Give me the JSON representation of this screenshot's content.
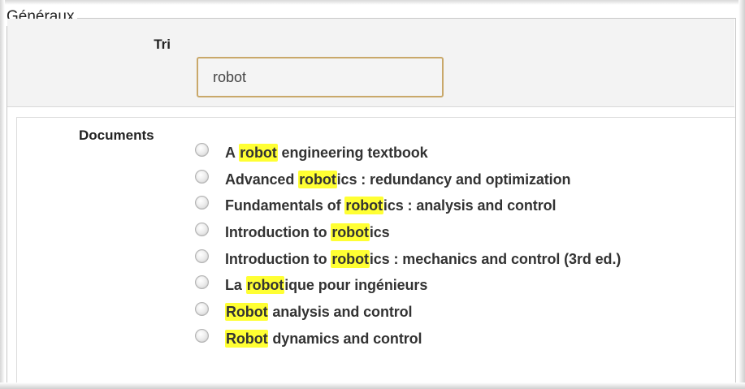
{
  "fieldset": {
    "legend": "Généraux"
  },
  "tri": {
    "label": "Tri",
    "value": "robot"
  },
  "documents": {
    "label": "Documents",
    "highlight_color": "#ffff33",
    "items": [
      {
        "before": "A ",
        "highlight": "robot",
        "after": " engineering textbook"
      },
      {
        "before": "Advanced ",
        "highlight": "robot",
        "after": "ics : redundancy and optimization"
      },
      {
        "before": "Fundamentals of ",
        "highlight": "robot",
        "after": "ics : analysis and control"
      },
      {
        "before": "Introduction to ",
        "highlight": "robot",
        "after": "ics"
      },
      {
        "before": "Introduction to ",
        "highlight": "robot",
        "after": "ics : mechanics and control (3rd ed.)"
      },
      {
        "before": "La ",
        "highlight": "robot",
        "after": "ique pour ingénieurs"
      },
      {
        "before": "",
        "highlight": "Robot",
        "after": " analysis and control"
      },
      {
        "before": "",
        "highlight": "Robot",
        "after": " dynamics and control"
      }
    ]
  }
}
